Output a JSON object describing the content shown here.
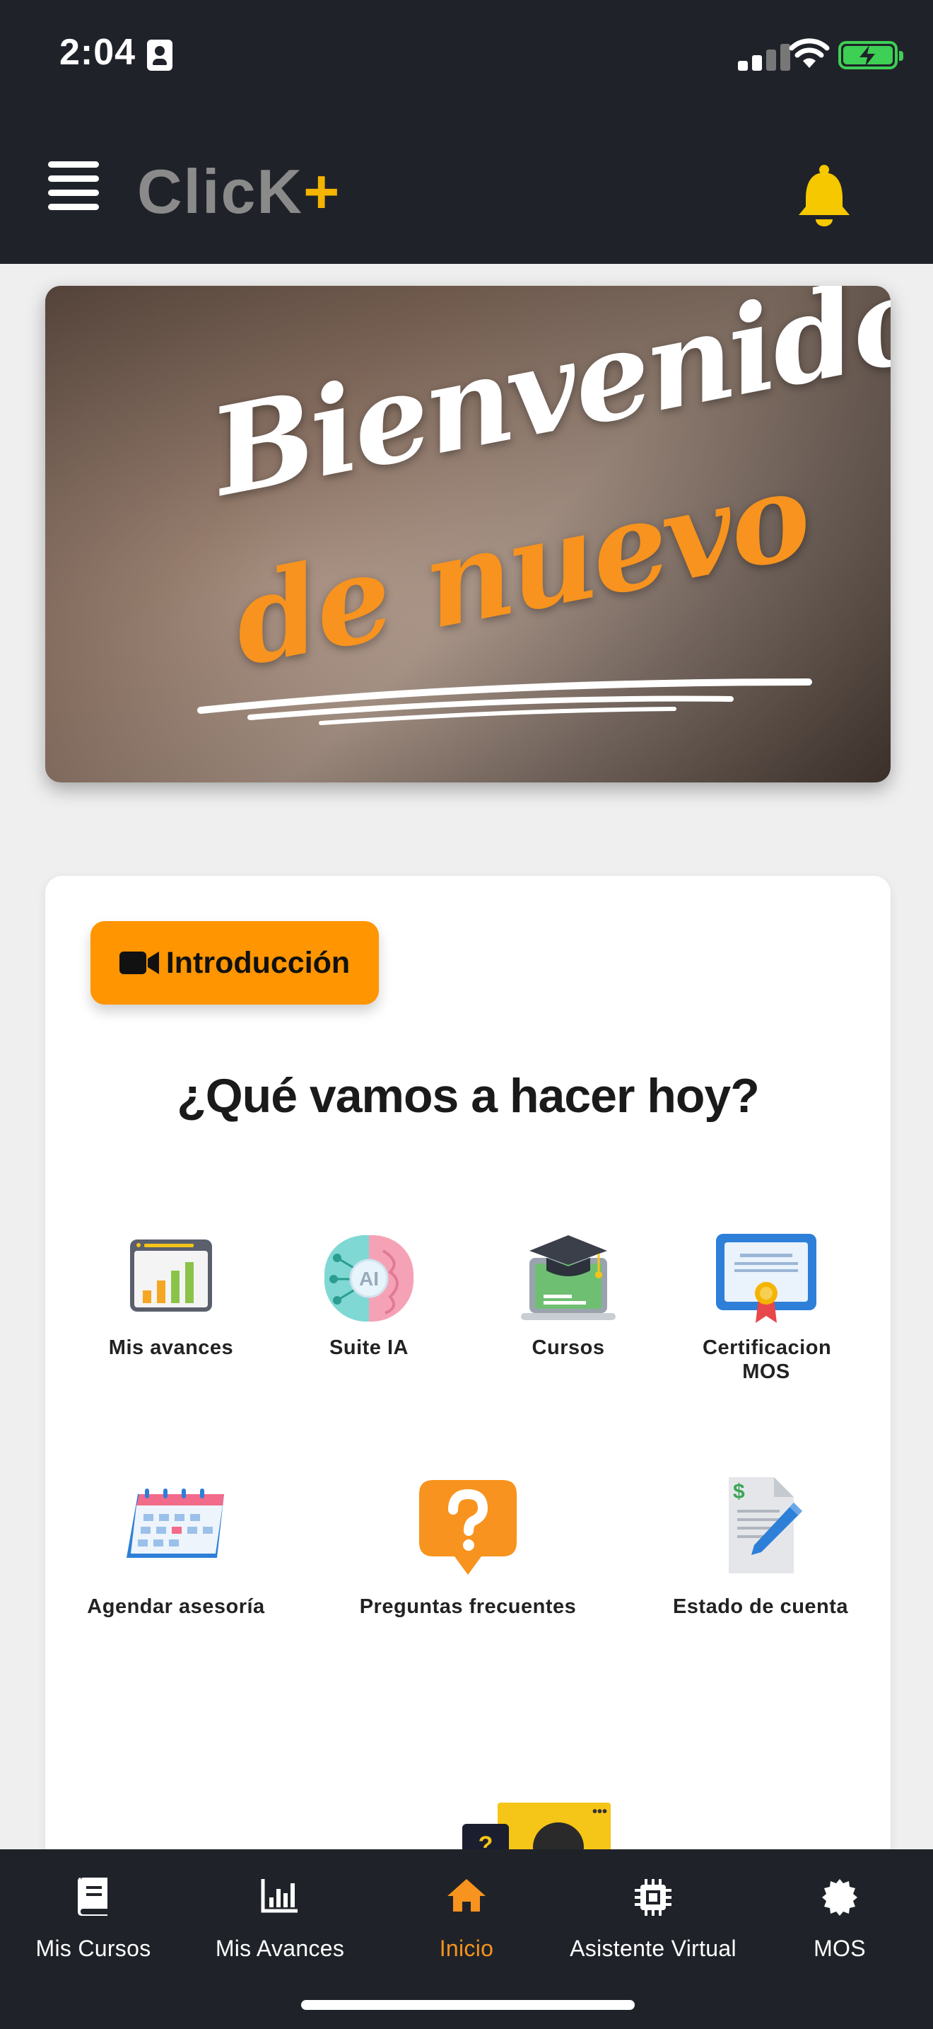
{
  "status": {
    "time": "2:04"
  },
  "header": {
    "logo_text": "ClicK",
    "logo_plus": "+"
  },
  "banner": {
    "line1": "Bienvenido",
    "line2": "de nuevo"
  },
  "card": {
    "intro_button": "Introducción",
    "title": "¿Qué vamos a hacer hoy?",
    "tiles_row1": [
      {
        "label": "Mis avances",
        "icon": "bar-chart-icon"
      },
      {
        "label": "Suite IA",
        "icon": "ai-brain-icon"
      },
      {
        "label": "Cursos",
        "icon": "graduation-laptop-icon"
      },
      {
        "label": "Certificacion MOS",
        "icon": "certificate-icon"
      }
    ],
    "tiles_row2": [
      {
        "label": "Agendar asesoría",
        "icon": "calendar-icon"
      },
      {
        "label": "Preguntas frecuentes",
        "icon": "question-bubble-icon"
      },
      {
        "label": "Estado de cuenta",
        "icon": "invoice-pen-icon"
      }
    ]
  },
  "tabbar": {
    "items": [
      {
        "label": "Mis Cursos",
        "icon": "book-icon"
      },
      {
        "label": "Mis Avances",
        "icon": "stats-icon"
      },
      {
        "label": "Inicio",
        "icon": "home-icon",
        "active": true
      },
      {
        "label": "Asistente Virtual",
        "icon": "chip-icon"
      },
      {
        "label": "MOS",
        "icon": "badge-icon"
      }
    ]
  },
  "colors": {
    "header_bg": "#1f2329",
    "accent_orange": "#ff9500",
    "bell_yellow": "#f5c800",
    "tab_active": "#f7931e"
  }
}
